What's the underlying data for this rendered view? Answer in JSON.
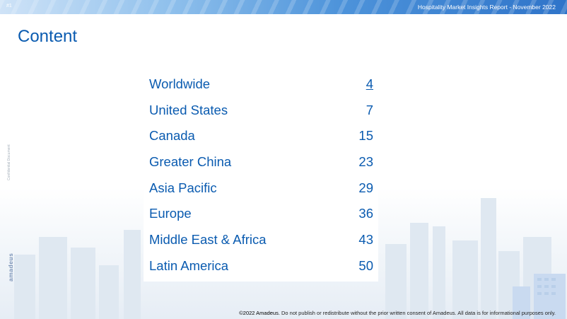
{
  "header": {
    "page_number": "#1",
    "report_title": "Hospitality Market Insights Report - November 2022"
  },
  "title": "Content",
  "side": {
    "confidential": "Confidential Document",
    "logo_text": "amadeus"
  },
  "toc": [
    {
      "label": "Worldwide",
      "page": "4"
    },
    {
      "label": "United States",
      "page": "7"
    },
    {
      "label": "Canada",
      "page": "15"
    },
    {
      "label": "Greater China",
      "page": "23"
    },
    {
      "label": "Asia Pacific",
      "page": "29"
    },
    {
      "label": "Europe",
      "page": "36"
    },
    {
      "label": "Middle East & Africa",
      "page": "43"
    },
    {
      "label": "Latin America",
      "page": "50"
    }
  ],
  "footer": {
    "lead": "©2022 Amadeus.",
    "text": " Do not publish or redistribute without the prior written consent of Amadeus. All data is for informational purposes only."
  },
  "colors": {
    "accent": "#0a5bb0",
    "topbar": "#2f74c9"
  }
}
